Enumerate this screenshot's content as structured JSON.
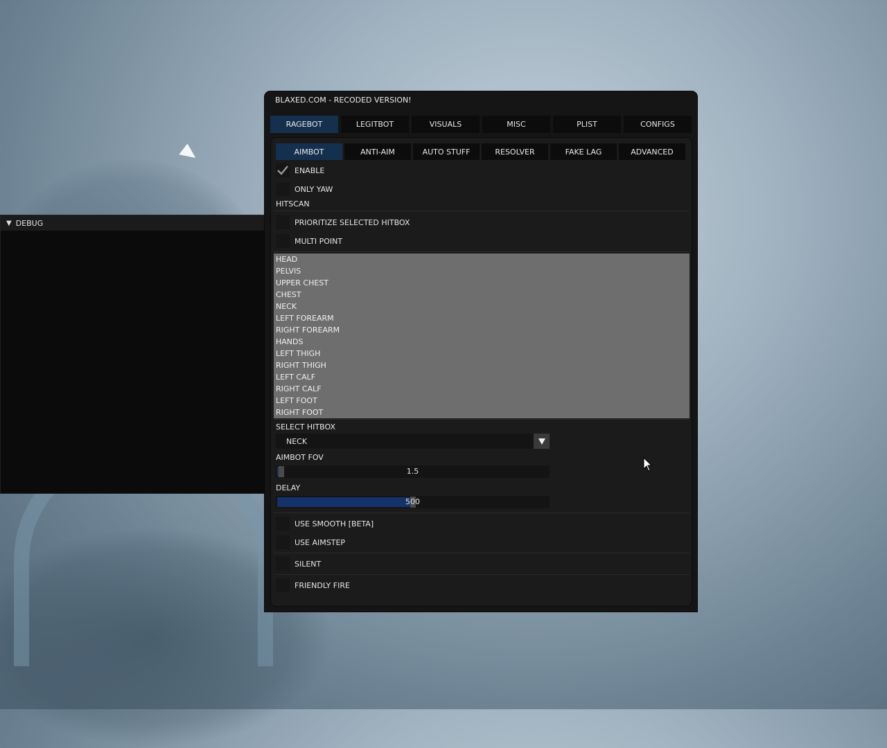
{
  "main_window": {
    "title": "BLAXED.COM - RECODED VERSION!",
    "tabs": [
      "RAGEBOT",
      "LEGITBOT",
      "VISUALS",
      "MISC",
      "PLIST",
      "CONFIGS"
    ],
    "active_tab": "RAGEBOT",
    "subtabs": [
      "AIMBOT",
      "ANTI-AIM",
      "AUTO STUFF",
      "RESOLVER",
      "FAKE LAG",
      "ADVANCED"
    ],
    "active_subtab": "AIMBOT"
  },
  "aimbot": {
    "enable": {
      "label": "ENABLE",
      "checked": true
    },
    "only_yaw": {
      "label": "ONLY YAW",
      "checked": false
    },
    "hitscan_label": "HITSCAN",
    "prioritize": {
      "label": "PRIORITIZE SELECTED HITBOX",
      "checked": false
    },
    "multi_point": {
      "label": "MULTI POINT",
      "checked": false
    },
    "hitbox_list": [
      "HEAD",
      "PELVIS",
      "UPPER CHEST",
      "CHEST",
      "NECK",
      "LEFT FOREARM",
      "RIGHT FOREARM",
      "HANDS",
      "LEFT THIGH",
      "RIGHT THIGH",
      "LEFT CALF",
      "RIGHT CALF",
      "LEFT FOOT",
      "RIGHT FOOT"
    ],
    "select_hitbox_label": "SELECT HITBOX",
    "select_hitbox_value": "NECK",
    "aimbot_fov_label": "AIMBOT FOV",
    "aimbot_fov_value": "1.5",
    "aimbot_fov_fraction": 0.015,
    "delay_label": "DELAY",
    "delay_value": "500",
    "delay_fraction": 0.5,
    "use_smooth": {
      "label": "USE SMOOTH [BETA]",
      "checked": false
    },
    "use_aimstep": {
      "label": "USE AIMSTEP",
      "checked": false
    },
    "silent": {
      "label": "SILENT",
      "checked": false
    },
    "friendly_fire": {
      "label": "FRIENDLY FIRE",
      "checked": false
    }
  },
  "debug_window": {
    "title": "DEBUG"
  },
  "colors": {
    "active_tab": "#15304e",
    "slider_fill": "#16326a",
    "list_bg": "#6e6e6e"
  }
}
